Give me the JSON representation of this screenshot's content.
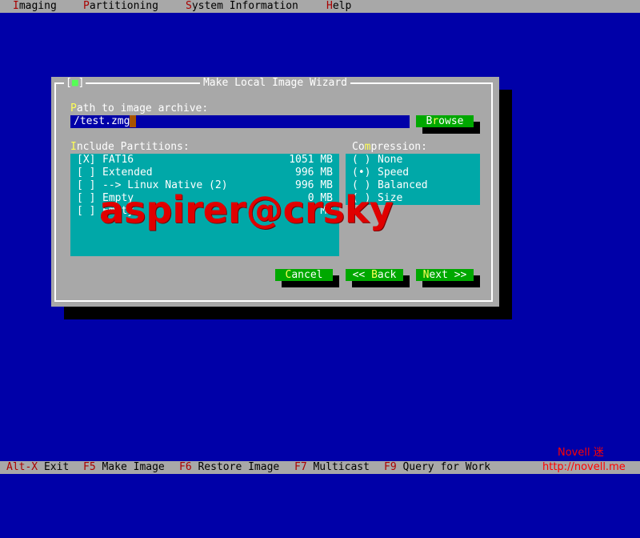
{
  "menubar": {
    "items": [
      {
        "hotkey": "I",
        "rest": "maging"
      },
      {
        "hotkey": "P",
        "rest": "artitioning"
      },
      {
        "hotkey": "S",
        "rest": "ystem Information"
      },
      {
        "hotkey": "H",
        "rest": "elp"
      }
    ]
  },
  "dialog": {
    "title": "Make Local Image Wizard",
    "close_control": {
      "open": "[",
      "mark": "■",
      "close": "]"
    },
    "path_label": {
      "first": "P",
      "rest": "ath to image archive:"
    },
    "path_value": "/test.zmg",
    "browse_button": {
      "first": "B",
      "hotkey": "r",
      "rest": "owse"
    },
    "partitions_label": {
      "first": "I",
      "rest": "nclude Partitions:"
    },
    "partitions": [
      {
        "check": "[X]",
        "name": "FAT16",
        "size": "1051 MB"
      },
      {
        "check": "[ ]",
        "name": "Extended",
        "size": "996 MB"
      },
      {
        "check": "[ ]",
        "name": "--> Linux Native (2)",
        "size": "996 MB"
      },
      {
        "check": "[ ]",
        "name": "Empty",
        "size": "0 MB"
      },
      {
        "check": "[ ]",
        "name": "Empty",
        "size": "0 MB"
      }
    ],
    "compression_label": {
      "pre": "Co",
      "hotkey": "m",
      "rest": "pression:"
    },
    "compression_options": [
      {
        "radio": "( )",
        "name": "None"
      },
      {
        "radio": "(•)",
        "name": "Speed"
      },
      {
        "radio": "( )",
        "name": "Balanced"
      },
      {
        "radio": "( )",
        "name": "Size"
      }
    ],
    "cancel_button": {
      "first": "C",
      "rest": "ancel"
    },
    "back_button": {
      "pre": "<< ",
      "hotkey": "B",
      "rest": "ack"
    },
    "next_button": {
      "first": "N",
      "rest": "ext >>"
    }
  },
  "watermark": "aspirer@crsky",
  "statusbar": {
    "items": [
      {
        "key": "Alt-X",
        "label": "Exit"
      },
      {
        "key": "F5",
        "label": "Make Image"
      },
      {
        "key": "F6",
        "label": "Restore Image"
      },
      {
        "key": "F7",
        "label": "Multicast"
      },
      {
        "key": "F9",
        "label": "Query for Work"
      }
    ]
  },
  "branding": {
    "name": "Novell 迷",
    "url": "http://novell.me"
  },
  "colors": {
    "desktop": "#0000a8",
    "dialog": "#a8a8a8",
    "list": "#00a8a8",
    "button": "#00a800",
    "hotkey": "#ffff55",
    "menu_hotkey": "#a80000"
  }
}
